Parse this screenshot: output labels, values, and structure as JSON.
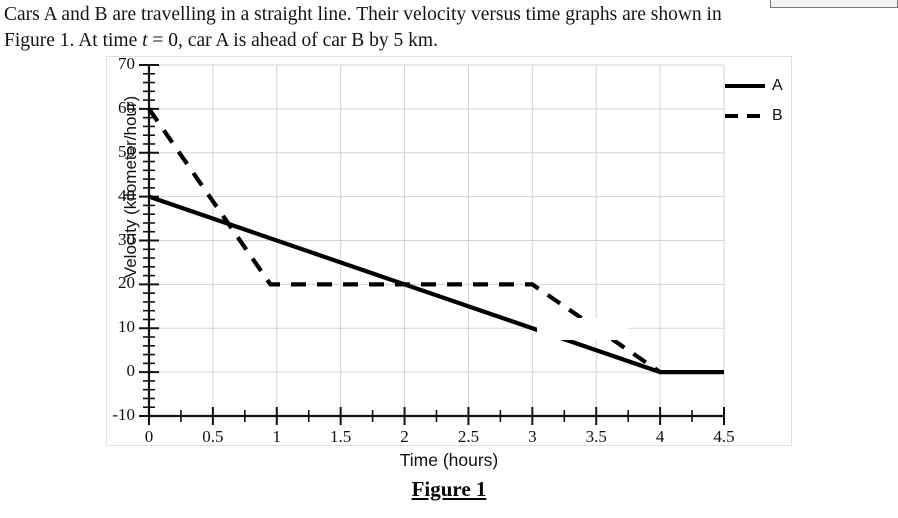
{
  "problem": {
    "line1_a": "Cars A and B are travelling in a straight line. Their velocity versus time graphs are shown in",
    "line2_a": "Figure 1. At time ",
    "line2_var": "t",
    "line2_b": " = 0, car A is ahead of car B by 5 km."
  },
  "figure": {
    "caption": "Figure 1"
  },
  "chart_data": {
    "type": "line",
    "title": "",
    "xlabel": "Time (hours)",
    "ylabel": "Velocity (kilometer/hour)",
    "xlim": [
      0,
      4.5
    ],
    "ylim": [
      -10,
      70
    ],
    "grid": true,
    "legend_position": "right",
    "x_ticks": [
      "0",
      "0.5",
      "1",
      "1.5",
      "2",
      "2.5",
      "3",
      "3.5",
      "4",
      "4.5"
    ],
    "x_tick_values": [
      0,
      0.5,
      1,
      1.5,
      2,
      2.5,
      3,
      3.5,
      4,
      4.5
    ],
    "x_minor_step": 0.25,
    "y_ticks": [
      "-10",
      "0",
      "10",
      "20",
      "30",
      "40",
      "50",
      "60",
      "70"
    ],
    "y_tick_values": [
      -10,
      0,
      10,
      20,
      30,
      40,
      50,
      60,
      70
    ],
    "y_minor_step": 2,
    "series": [
      {
        "name": "A",
        "style": "solid",
        "color": "#000000",
        "points": [
          [
            0,
            40
          ],
          [
            4,
            0
          ],
          [
            4.5,
            0
          ]
        ]
      },
      {
        "name": "B",
        "style": "dashed",
        "color": "#000000",
        "points": [
          [
            0,
            60
          ],
          [
            0.95,
            20
          ],
          [
            3,
            20
          ],
          [
            4,
            0
          ]
        ]
      }
    ],
    "legend": [
      {
        "label": "A",
        "style": "solid"
      },
      {
        "label": "B",
        "style": "dashed"
      }
    ]
  }
}
